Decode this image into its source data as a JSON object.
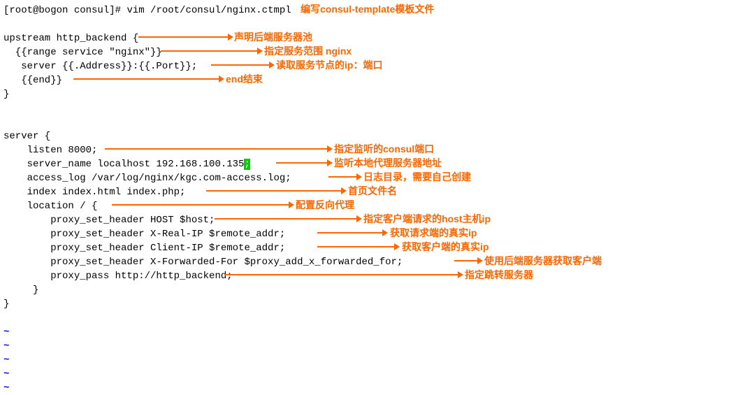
{
  "prompt": "[root@bogon consul]# ",
  "cmd": "vim /root/consul/nginx.ctmpl",
  "code": {
    "l1": "upstream http_backend {",
    "l2": "  {{range service \"nginx\"}}",
    "l3": "   server {{.Address}}:{{.Port}};",
    "l4": "   {{end}}",
    "l5": "}",
    "l6": "server {",
    "l7": "    listen 8000;",
    "l8a": "    server_name localhost 192.168.100.135",
    "l8b": ";",
    "l9": "    access_log /var/log/nginx/kgc.com-access.log;",
    "l10": "    index index.html index.php;",
    "l11": "    location / {",
    "l12": "        proxy_set_header HOST $host;",
    "l13": "        proxy_set_header X-Real-IP $remote_addr;",
    "l14": "        proxy_set_header Client-IP $remote_addr;",
    "l15": "        proxy_set_header X-Forwarded-For $proxy_add_x_forwarded_for;",
    "l16": "        proxy_pass http://http_backend;",
    "l17": "     }",
    "l18": "}"
  },
  "ann": {
    "a0": "编写consul-template模板文件",
    "a1": "声明后端服务器池",
    "a2": "指定服务范围 nginx",
    "a3": "读取服务节点的ip：端口",
    "a4": "end结束",
    "a5": "指定监听的consul端口",
    "a6": "监听本地代理服务器地址",
    "a7": "日志目录，需要自己创建",
    "a8": "首页文件名",
    "a9": "配置反向代理",
    "a10": "指定客户端请求的host主机ip",
    "a11": "获取请求端的真实ip",
    "a12": "获取客户端的真实ip",
    "a13": "使用后端服务器获取客户端",
    "a14": "指定跳转服务器"
  },
  "tilde": "~"
}
